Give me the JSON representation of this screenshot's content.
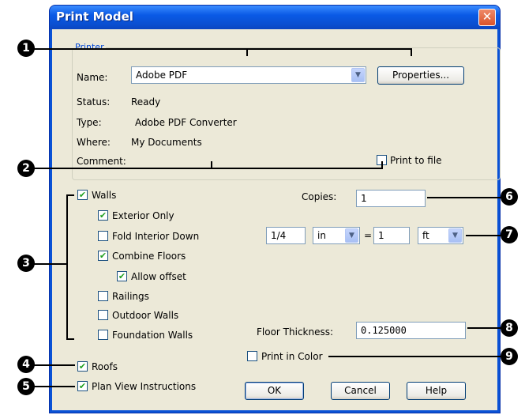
{
  "dialog": {
    "title": "Print Model",
    "close_glyph": "✕"
  },
  "printer": {
    "group_label": "Printer",
    "name_label": "Name:",
    "name_value": "Adobe PDF",
    "properties_button": "Properties...",
    "status_label": "Status:",
    "status_value": "Ready",
    "type_label": "Type:",
    "type_value": "Adobe PDF Converter",
    "where_label": "Where:",
    "where_value": "My Documents",
    "comment_label": "Comment:",
    "print_to_file_label": "Print to file",
    "print_to_file_checked": false
  },
  "options": {
    "walls": {
      "label": "Walls",
      "checked": true
    },
    "exterior_only": {
      "label": "Exterior Only",
      "checked": true
    },
    "fold_interior_down": {
      "label": "Fold Interior Down",
      "checked": false
    },
    "combine_floors": {
      "label": "Combine Floors",
      "checked": true
    },
    "allow_offset": {
      "label": "Allow offset",
      "checked": true
    },
    "railings": {
      "label": "Railings",
      "checked": false
    },
    "outdoor_walls": {
      "label": "Outdoor Walls",
      "checked": false
    },
    "foundation_walls": {
      "label": "Foundation Walls",
      "checked": false
    },
    "roofs": {
      "label": "Roofs",
      "checked": true
    },
    "plan_view_instructions": {
      "label": "Plan View Instructions",
      "checked": true
    },
    "print_in_color": {
      "label": "Print in Color",
      "checked": false
    }
  },
  "copies": {
    "label": "Copies:",
    "value": "1"
  },
  "scale": {
    "paper_value": "1/4",
    "paper_unit": "in",
    "equals": "=",
    "model_value": "1",
    "model_unit": "ft"
  },
  "floor_thickness": {
    "label": "Floor Thickness:",
    "value": "0.125000"
  },
  "buttons": {
    "ok": "OK",
    "cancel": "Cancel",
    "help": "Help"
  },
  "callouts": [
    "1",
    "2",
    "3",
    "4",
    "5",
    "6",
    "7",
    "8",
    "9"
  ],
  "colors": {
    "title_bar": "#0a52d6",
    "client_bg": "#ece9d8",
    "check_mark": "#21a121"
  }
}
